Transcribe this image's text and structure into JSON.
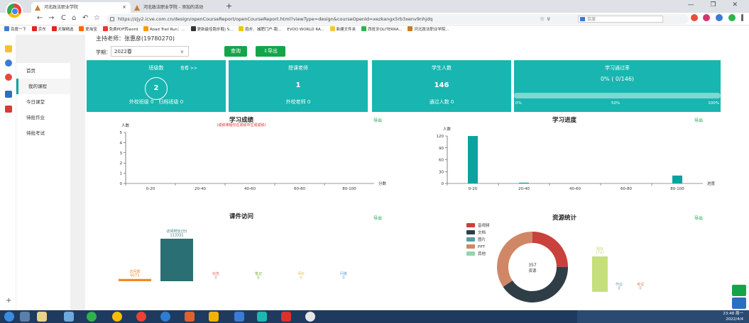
{
  "browser": {
    "tabs": [
      {
        "title": "河北政法职业学院",
        "close": "×"
      },
      {
        "title": "河北政法职业学院 - 添加的活动",
        "close": "×"
      }
    ],
    "new_tab": "+",
    "url": "https://zjy2.icve.com.cn/design/openCourseReport/openCourseReport.html?viewType=design&courseOpenId=xezkangx5rb3xenv9nhjdq",
    "search_placeholder": "百度",
    "window_controls": "— ❐ ✕",
    "nav": {
      "back": "←",
      "forward": "→",
      "reload": "C",
      "home": "⌂",
      "undo": "↶",
      "star": "☆",
      "address_star": "☆ ∨"
    },
    "bookmarks": [
      "百度一下",
      "京东",
      "天猫精选",
      "爱淘宝",
      "免费PDF转word",
      "Road Trail Run：...",
      "更新最佳跑步鞋| S...",
      "跑步、减肥门户-跑...",
      "EVOO WORLD RA...",
      "新建文件夹",
      "西班牙OLITERRA...",
      "河北政法职业学院..."
    ]
  },
  "page": {
    "teacher": "主持老师：张惠彦(19780270)",
    "term_label": "学期：",
    "term_value": "2022春",
    "term_chevron": "∨",
    "query_button": "查询",
    "export_button": "⇩导出"
  },
  "menu": [
    {
      "label": "首页",
      "active": false
    },
    {
      "label": "我的课程",
      "active": true
    },
    {
      "label": "今日课堂",
      "active": false
    },
    {
      "label": "待批作业",
      "active": false
    },
    {
      "label": "待批考试",
      "active": false
    }
  ],
  "cards": {
    "classes": {
      "title": "班级数",
      "view_more": "查看 >>",
      "value": "2",
      "sub": "外校班级 0　归档班级 0"
    },
    "teachers": {
      "title": "授课老师",
      "value": "1",
      "sub": "外校老师 0"
    },
    "students": {
      "title": "学生人数",
      "value": "146",
      "sub": "通过人数 0"
    },
    "pass_rate": {
      "title": "学习通过率",
      "value": "0% ( 0/146)",
      "fraction": 0,
      "ticks": [
        "0%",
        "50%",
        "100%"
      ]
    }
  },
  "export_link": "导出",
  "colors": {
    "accent": "#19b5b0",
    "bar": "#0aa3a1",
    "green": "#14a54a",
    "audio": "#c8413c",
    "doc": "#2f3e46",
    "image": "#5a9ba0",
    "ppt": "#d08766",
    "other": "#94d3b0"
  },
  "chart_data": [
    {
      "type": "bar",
      "title": "学习成绩",
      "subtitle": "(成绩课程仅在成绩中生成成绩)",
      "ylabel": "人数",
      "xlabel": "分数",
      "categories": [
        "0-20",
        "20-40",
        "40-60",
        "60-80",
        "80-100"
      ],
      "values": [
        0,
        0,
        0,
        0,
        0
      ],
      "ylim": [
        0,
        5
      ],
      "yticks": [
        0,
        1,
        2,
        3,
        4,
        5
      ]
    },
    {
      "type": "bar",
      "title": "学习进度",
      "ylabel": "人数",
      "xlabel": "进度",
      "categories": [
        "0-20",
        "20-40",
        "40-60",
        "60-80",
        "80-100"
      ],
      "values": [
        124,
        2,
        0,
        0,
        20
      ],
      "ylim": [
        0,
        120
      ],
      "yticks": [
        0,
        30,
        60,
        90,
        120
      ]
    },
    {
      "type": "bar",
      "title": "课件访问",
      "categories": [
        "访问数",
        "访问时长(分)",
        "标签",
        "笔记",
        "评价",
        "问答"
      ],
      "values": [
        6073,
        113331,
        0,
        0,
        0,
        0
      ],
      "labels": [
        "访问数\n6073",
        "访问时长(分)\n113331",
        "标签\n0",
        "笔记\n0",
        "评价\n0",
        "问答\n0"
      ],
      "colors": [
        "#f08a24",
        "#2a6f73",
        "#e07070",
        "#7aab3a",
        "#e6b84a",
        "#5b9bd5"
      ]
    },
    {
      "type": "pie",
      "title": "资源统计",
      "legend": [
        "音视频",
        "文档",
        "图片",
        "PPT",
        "其他"
      ],
      "values": [
        89,
        145,
        0,
        123,
        0
      ],
      "center_label": "357",
      "center_sub": "资源"
    },
    {
      "type": "bar",
      "title": "",
      "categories": [
        "题库",
        "作业",
        "考试"
      ],
      "values": [
        1747,
        0,
        0
      ],
      "labels": [
        "题库\n1747",
        "作业\n0",
        "考试\n0"
      ],
      "colors": [
        "#c5e07a",
        "#5a9ba0",
        "#d08766"
      ]
    }
  ],
  "taskbar": {
    "time": "23:48 周一",
    "date": "2022/4/4"
  }
}
